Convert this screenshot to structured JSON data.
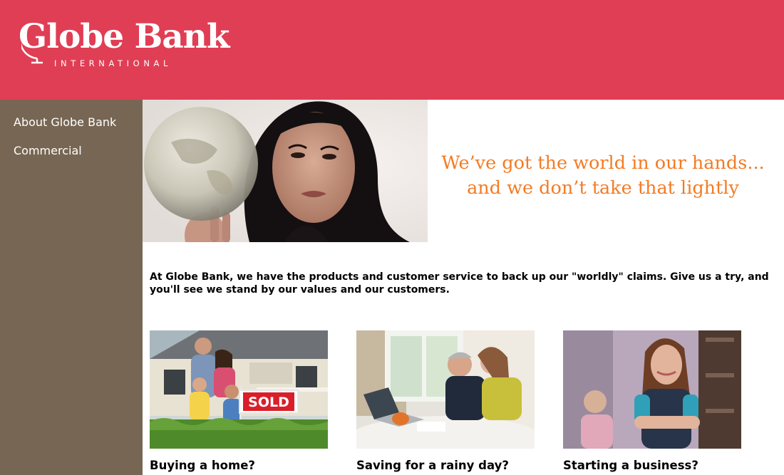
{
  "brand": {
    "name": "Globe Bank",
    "subtitle": "INTERNATIONAL",
    "primary_color": "#e03e55",
    "sidebar_color": "#776653",
    "tagline_color": "#f37b24"
  },
  "sidebar": {
    "items": [
      {
        "label": "About Globe Bank"
      },
      {
        "label": "Commercial"
      }
    ]
  },
  "hero": {
    "tagline_line1": "We’ve got the world in our hands...",
    "tagline_line2": "and we don’t take that lightly"
  },
  "intro": {
    "text": "At Globe Bank, we have the products and customer service to back up our \"worldly\" claims. Give us a try, and you'll see we stand by our values and our customers."
  },
  "cards": [
    {
      "title": "Buying a home?",
      "sign_text": "SOLD"
    },
    {
      "title": "Saving for a rainy day?"
    },
    {
      "title": "Starting a business?"
    }
  ]
}
